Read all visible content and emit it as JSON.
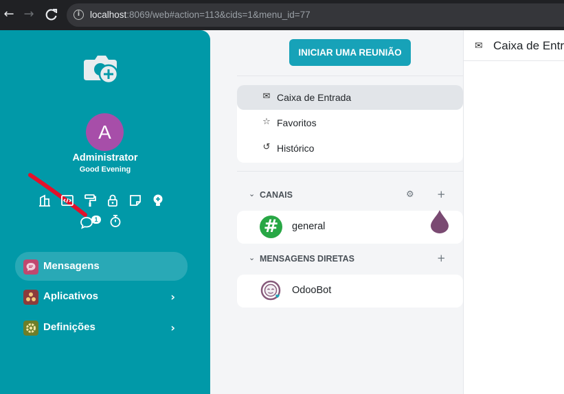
{
  "browser": {
    "back_icon": "←",
    "forward_icon": "→",
    "reload_icon": "C",
    "info_icon": "i",
    "url_host": "localhost",
    "url_rest": ":8069/web#action=113&cids=1&menu_id=77"
  },
  "sidebar": {
    "avatar_letter": "A",
    "user_name": "Administrator",
    "greeting": "Good Evening",
    "notification_count": "1",
    "menu": [
      {
        "label": "Mensagens",
        "icon": "messages-icon",
        "active": true
      },
      {
        "label": "Aplicativos",
        "icon": "apps-icon",
        "chevron": "›"
      },
      {
        "label": "Definições",
        "icon": "settings-icon",
        "chevron": "›"
      }
    ],
    "accent_color": "#0199a8"
  },
  "discuss": {
    "start_meeting_label": "INICIAR UMA REUNIÃO",
    "nav": [
      {
        "label": "Caixa de Entrada",
        "icon": "inbox-icon",
        "glyph": "✉",
        "active": true
      },
      {
        "label": "Favoritos",
        "icon": "star-icon",
        "glyph": "☆"
      },
      {
        "label": "Histórico",
        "icon": "history-icon",
        "glyph": "↺"
      }
    ],
    "channels": {
      "header": "CANAIS",
      "chevron": "⌄",
      "settings_glyph": "⚙",
      "add_glyph": "+",
      "items": [
        {
          "label": "general",
          "glyph": "#"
        }
      ]
    },
    "direct": {
      "header": "MENSAGENS DIRETAS",
      "chevron": "⌄",
      "add_glyph": "+",
      "items": [
        {
          "label": "OdooBot"
        }
      ]
    }
  },
  "thread": {
    "icon_glyph": "✉",
    "title": "Caixa de Entrada"
  }
}
